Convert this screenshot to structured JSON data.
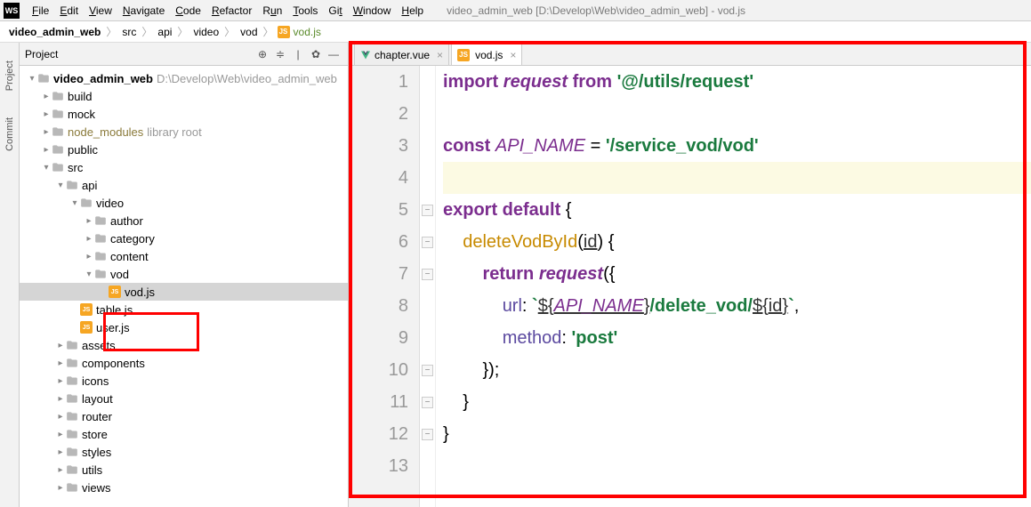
{
  "menubar": {
    "items": [
      {
        "label": "File",
        "u": "F"
      },
      {
        "label": "Edit",
        "u": "E"
      },
      {
        "label": "View",
        "u": "V"
      },
      {
        "label": "Navigate",
        "u": "N"
      },
      {
        "label": "Code",
        "u": "C"
      },
      {
        "label": "Refactor",
        "u": "R"
      },
      {
        "label": "Run",
        "u": "u"
      },
      {
        "label": "Tools",
        "u": "T"
      },
      {
        "label": "Git",
        "u": "t"
      },
      {
        "label": "Window",
        "u": "W"
      },
      {
        "label": "Help",
        "u": "H"
      }
    ],
    "title": "video_admin_web [D:\\Develop\\Web\\video_admin_web] - vod.js"
  },
  "breadcrumbs": [
    "video_admin_web",
    "src",
    "api",
    "video",
    "vod",
    "vod.js"
  ],
  "sidebar": {
    "project_label": "Project",
    "commit_label": "Commit",
    "panel_title": "Project"
  },
  "tree": [
    {
      "depth": 0,
      "arrow": "▾",
      "kind": "folder",
      "label": "video_admin_web",
      "suffix": "D:\\Develop\\Web\\video_admin_web",
      "bold": true
    },
    {
      "depth": 1,
      "arrow": "▸",
      "kind": "folder",
      "label": "build"
    },
    {
      "depth": 1,
      "arrow": "▸",
      "kind": "folder",
      "label": "mock"
    },
    {
      "depth": 1,
      "arrow": "▸",
      "kind": "folder",
      "label": "node_modules",
      "suffix": "library root",
      "yellow": true
    },
    {
      "depth": 1,
      "arrow": "▸",
      "kind": "folder",
      "label": "public"
    },
    {
      "depth": 1,
      "arrow": "▾",
      "kind": "folder",
      "label": "src"
    },
    {
      "depth": 2,
      "arrow": "▾",
      "kind": "folder",
      "label": "api"
    },
    {
      "depth": 3,
      "arrow": "▾",
      "kind": "folder",
      "label": "video"
    },
    {
      "depth": 4,
      "arrow": "▸",
      "kind": "folder",
      "label": "author"
    },
    {
      "depth": 4,
      "arrow": "▸",
      "kind": "folder",
      "label": "category"
    },
    {
      "depth": 4,
      "arrow": "▸",
      "kind": "folder",
      "label": "content"
    },
    {
      "depth": 4,
      "arrow": "▾",
      "kind": "folder",
      "label": "vod"
    },
    {
      "depth": 5,
      "arrow": "",
      "kind": "js",
      "label": "vod.js",
      "selected": true
    },
    {
      "depth": 3,
      "arrow": "",
      "kind": "js",
      "label": "table.js"
    },
    {
      "depth": 3,
      "arrow": "",
      "kind": "js",
      "label": "user.js"
    },
    {
      "depth": 2,
      "arrow": "▸",
      "kind": "folder",
      "label": "assets"
    },
    {
      "depth": 2,
      "arrow": "▸",
      "kind": "folder",
      "label": "components"
    },
    {
      "depth": 2,
      "arrow": "▸",
      "kind": "folder",
      "label": "icons"
    },
    {
      "depth": 2,
      "arrow": "▸",
      "kind": "folder",
      "label": "layout"
    },
    {
      "depth": 2,
      "arrow": "▸",
      "kind": "folder",
      "label": "router"
    },
    {
      "depth": 2,
      "arrow": "▸",
      "kind": "folder",
      "label": "store"
    },
    {
      "depth": 2,
      "arrow": "▸",
      "kind": "folder",
      "label": "styles"
    },
    {
      "depth": 2,
      "arrow": "▸",
      "kind": "folder",
      "label": "utils"
    },
    {
      "depth": 2,
      "arrow": "▸",
      "kind": "folder",
      "label": "views"
    }
  ],
  "tabs": [
    {
      "icon": "vue",
      "label": "chapter.vue",
      "active": false
    },
    {
      "icon": "js",
      "label": "vod.js",
      "active": true
    }
  ],
  "code": {
    "lines": [
      {
        "n": 1,
        "html": "<span class='kw'>import</span> <span class='kw-it'>request</span> <span class='kw'>from</span> <span class='str'>'@/utils/request'</span>"
      },
      {
        "n": 2,
        "html": ""
      },
      {
        "n": 3,
        "html": "<span class='kw'>const</span> <span class='ident'>API_NAME</span> = <span class='str'>'/service_vod/vod'</span>"
      },
      {
        "n": 4,
        "html": "",
        "current": true
      },
      {
        "n": 5,
        "html": "<span class='kw'>export default</span> {"
      },
      {
        "n": 6,
        "html": "    <span class='func'>deleteVodById</span>(<span class='param'>id</span>) {"
      },
      {
        "n": 7,
        "html": "        <span class='kw'>return</span> <span class='kw-it'>request</span>({"
      },
      {
        "n": 8,
        "html": "            <span class='prop'>url</span>: <span class='str'>`</span><span class='param'>${<span class='ident'>API_NAME</span>}</span><span class='str'>/delete_vod/</span><span class='param'>${<u>id</u>}</span><span class='str'>`</span>,"
      },
      {
        "n": 9,
        "html": "            <span class='prop'>method</span>: <span class='str'>'post'</span>"
      },
      {
        "n": 10,
        "html": "        });"
      },
      {
        "n": 11,
        "html": "    }"
      },
      {
        "n": 12,
        "html": "}"
      },
      {
        "n": 13,
        "html": ""
      }
    ]
  }
}
